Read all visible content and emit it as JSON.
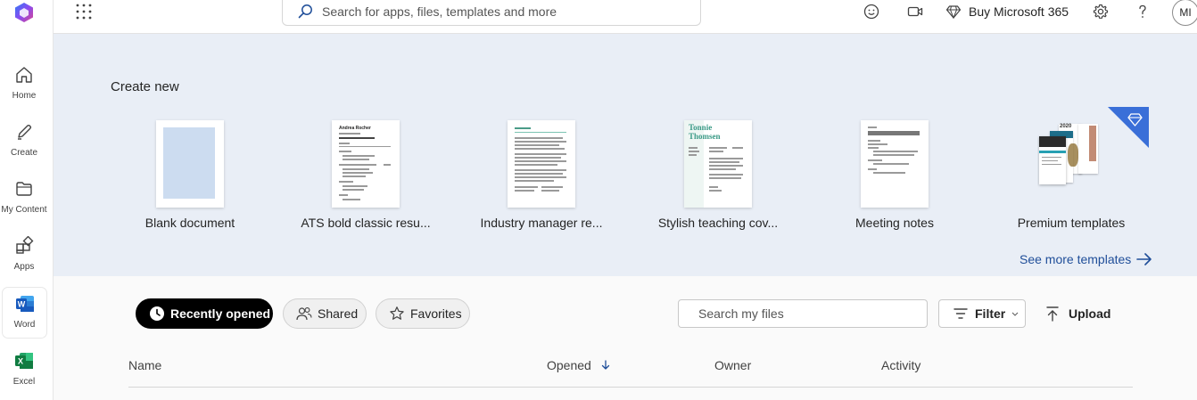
{
  "rail": {
    "items": [
      {
        "label": "Home",
        "icon": "home-icon"
      },
      {
        "label": "Create",
        "icon": "pen-icon"
      },
      {
        "label": "My Content",
        "icon": "folder-icon"
      },
      {
        "label": "Apps",
        "icon": "apps-icon"
      },
      {
        "label": "Word",
        "icon": "word-icon"
      },
      {
        "label": "Excel",
        "icon": "excel-icon"
      }
    ],
    "word_letter": "W",
    "excel_letter": "X"
  },
  "topbar": {
    "search_placeholder": "Search for apps, files, templates and more",
    "buy_label": "Buy Microsoft 365",
    "avatar_initials": "MI"
  },
  "create": {
    "title": "Create new",
    "templates": [
      {
        "label": "Blank document"
      },
      {
        "label": "ATS bold classic resu..."
      },
      {
        "label": "Industry manager re..."
      },
      {
        "label": "Stylish teaching cov..."
      },
      {
        "label": "Meeting notes"
      },
      {
        "label": "Premium templates"
      }
    ],
    "thumb_texts": {
      "ats_name": "Andrea Rocher",
      "stylish_name_1": "Tonnie",
      "stylish_name_2": "Thomsen",
      "premium_year": "2020"
    },
    "see_more": "See more templates"
  },
  "files": {
    "tabs": [
      {
        "label": "Recently opened"
      },
      {
        "label": "Shared"
      },
      {
        "label": "Favorites"
      }
    ],
    "search_placeholder": "Search my files",
    "filter_label": "Filter",
    "upload_label": "Upload",
    "columns": [
      "Name",
      "Opened",
      "Owner",
      "Activity"
    ]
  },
  "colors": {
    "accent": "#1f4e99",
    "word": "#185abd",
    "excel": "#107c41",
    "create_band": "#e9eef6",
    "premium_badge": "#3a6fd8"
  }
}
